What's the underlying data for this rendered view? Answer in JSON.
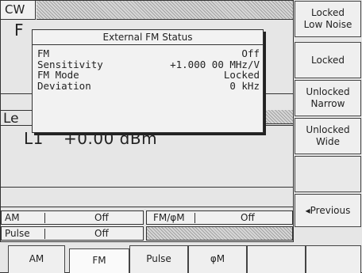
{
  "header": {
    "mode_label": "CW"
  },
  "main": {
    "partial_label": "F",
    "level_partial": "Le",
    "level_name": "L1",
    "level_value": "+0.00 dBm"
  },
  "popup": {
    "title": "External FM Status",
    "rows": [
      {
        "label": "FM",
        "value": "Off"
      },
      {
        "label": "Sensitivity",
        "value": "+1.000 00 MHz/V"
      },
      {
        "label": "FM Mode",
        "value": "Locked"
      },
      {
        "label": "Deviation",
        "value": "0 kHz"
      }
    ]
  },
  "status": {
    "am_label": "AM",
    "am_value": "Off",
    "fmpm_label": "FM/φM",
    "fmpm_value": "Off",
    "pulse_label": "Pulse",
    "pulse_value": "Off"
  },
  "softkeys": [
    "Locked\nLow Noise",
    "Locked",
    "Unlocked\nNarrow",
    "Unlocked\nWide",
    "",
    "◂Previous"
  ],
  "tabs": [
    "AM",
    "FM",
    "Pulse",
    "φM",
    "",
    ""
  ]
}
